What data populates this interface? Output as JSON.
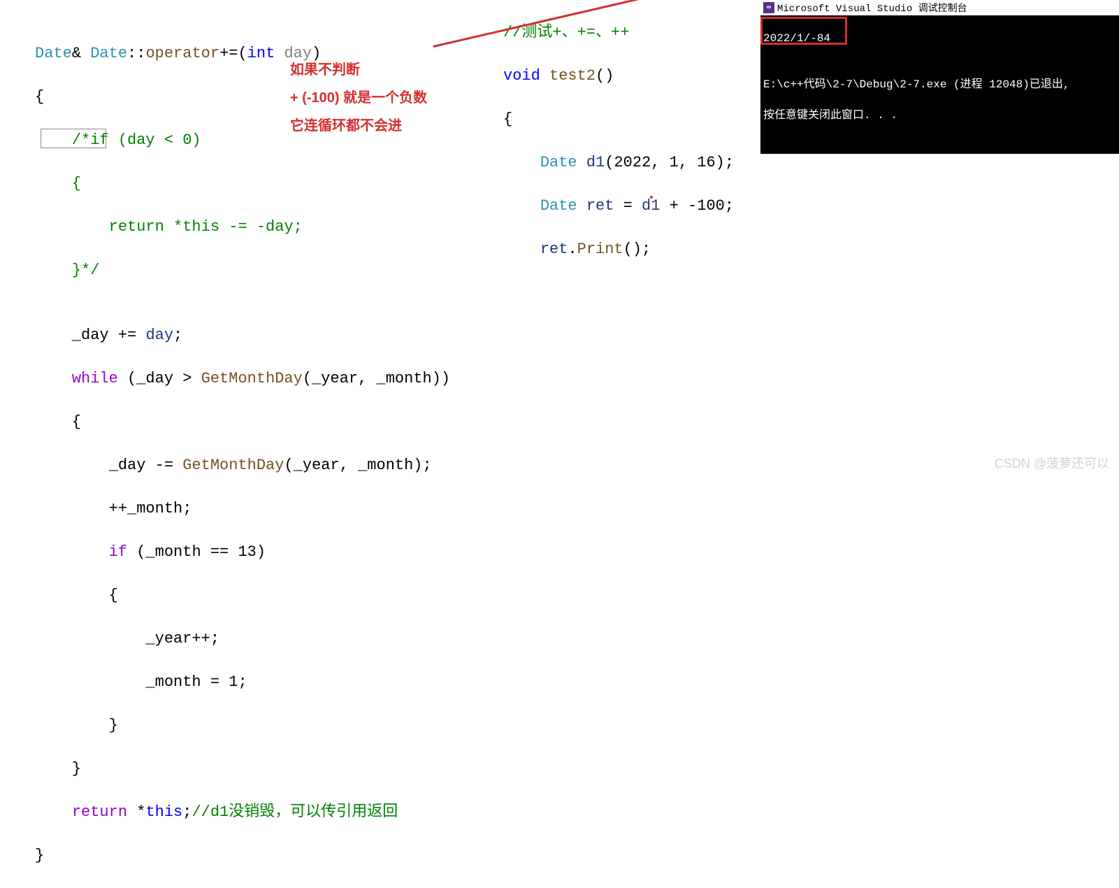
{
  "code_left": {
    "l1": {
      "p1": "Date",
      "p2": "&",
      "p3": " ",
      "p4": "Date",
      "p5": "::",
      "p6": "operator",
      "p7": "+=(",
      "p8": "int",
      "p9": " ",
      "p10": "day",
      "p11": ")"
    },
    "l2": "{",
    "l3": "    /*if (day < 0)",
    "l4": "    {",
    "l5": "        return *this -= -day;",
    "l6": "    }*/",
    "l7": "",
    "l8": {
      "p1": "    _day += ",
      "p2": "day",
      "p3": ";"
    },
    "l9": {
      "p1": "    ",
      "p2": "while",
      "p3": " (_day > ",
      "p4": "GetMonthDay",
      "p5": "(_year, _month))"
    },
    "l10": "    {",
    "l11": {
      "p1": "        _day -= ",
      "p2": "GetMonthDay",
      "p3": "(_year, _month);"
    },
    "l12": "        ++_month;",
    "l13": {
      "p1": "        ",
      "p2": "if",
      "p3": " (_month == 13)"
    },
    "l14": "        {",
    "l15": "            _year++;",
    "l16": "            _month = 1;",
    "l17": "        }",
    "l18": "    }",
    "l19": {
      "p1": "    ",
      "p2": "return",
      "p3": " *",
      "p4": "this",
      "p5": ";",
      "p6": "//d1没销毁，可以传引用返回"
    },
    "l20": "}"
  },
  "code_right": {
    "l0": "//测试+、+=、++",
    "l1": {
      "p1": "void",
      "p2": " ",
      "p3": "test2",
      "p4": "()"
    },
    "l2": "{",
    "l3": {
      "p1": "    ",
      "p2": "Date",
      "p3": " ",
      "p4": "d1",
      "p5": "(2022, 1, 16);"
    },
    "l4": {
      "p1": "    ",
      "p2": "Date",
      "p3": " ",
      "p4": "ret",
      "p5": " = ",
      "p6": "d1",
      "p7": " + -100;"
    },
    "l5": {
      "p1": "    ",
      "p2": "ret",
      "p3": ".",
      "p4": "Print",
      "p5": "();"
    }
  },
  "annotations": {
    "a1": "如果不判断",
    "a2": "+ (-100) 就是一个负数",
    "a3": "它连循环都不会进"
  },
  "console": {
    "title": "Microsoft Visual Studio 调试控制台",
    "icon_text": "⬚",
    "line1": "2022/1/-84",
    "line2": "",
    "line3": "E:\\c++代码\\2-7\\Debug\\2-7.exe (进程 12048)已退出,",
    "line4": "按任意键关闭此窗口. . ."
  },
  "watermark": "CSDN @菠萝还可以"
}
